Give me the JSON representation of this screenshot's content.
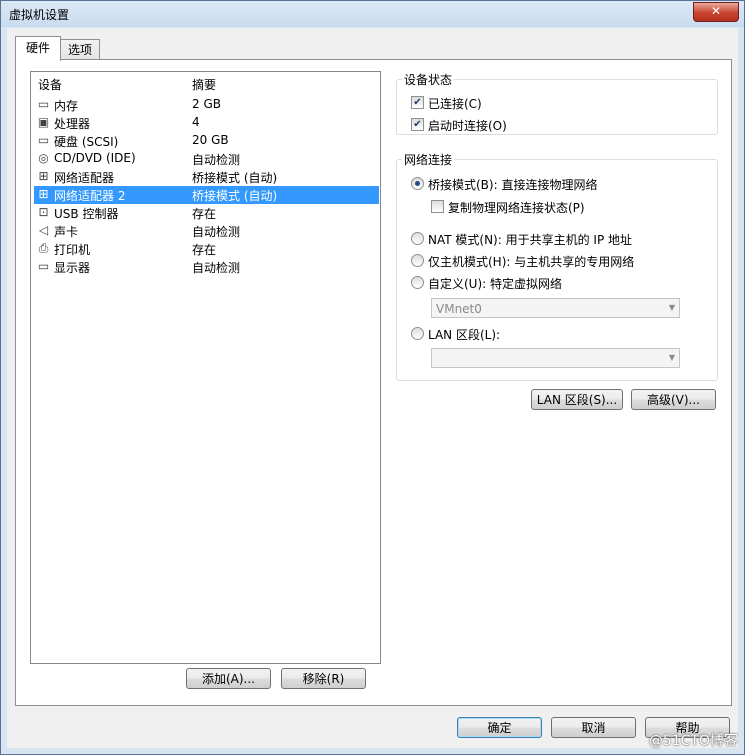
{
  "window": {
    "title": "虚拟机设置",
    "close_label": "✕"
  },
  "tabs": [
    {
      "label": "硬件"
    },
    {
      "label": "选项"
    }
  ],
  "device_list": {
    "headers": {
      "device": "设备",
      "summary": "摘要"
    },
    "rows": [
      {
        "icon": "memory-icon",
        "glyph": "▭",
        "name": "内存",
        "summary": "2 GB"
      },
      {
        "icon": "processor-icon",
        "glyph": "▣",
        "name": "处理器",
        "summary": "4"
      },
      {
        "icon": "harddisk-icon",
        "glyph": "▭",
        "name": "硬盘 (SCSI)",
        "summary": "20 GB"
      },
      {
        "icon": "cd-dvd-icon",
        "glyph": "◎",
        "name": "CD/DVD (IDE)",
        "summary": "自动检测"
      },
      {
        "icon": "network-adapter-icon",
        "glyph": "⊞",
        "name": "网络适配器",
        "summary": "桥接模式 (自动)"
      },
      {
        "icon": "network-adapter-icon",
        "glyph": "⊞",
        "name": "网络适配器 2",
        "summary": "桥接模式 (自动)",
        "selected": true
      },
      {
        "icon": "usb-controller-icon",
        "glyph": "⊡",
        "name": "USB 控制器",
        "summary": "存在"
      },
      {
        "icon": "sound-card-icon",
        "glyph": "◁",
        "name": "声卡",
        "summary": "自动检测"
      },
      {
        "icon": "printer-icon",
        "glyph": "⎙",
        "name": "打印机",
        "summary": "存在"
      },
      {
        "icon": "display-icon",
        "glyph": "▭",
        "name": "显示器",
        "summary": "自动检测"
      }
    ],
    "add_button": "添加(A)...",
    "remove_button": "移除(R)"
  },
  "device_status": {
    "title": "设备状态",
    "connected": {
      "label": "已连接(C)",
      "checked": true
    },
    "connect_at_power_on": {
      "label": "启动时连接(O)",
      "checked": true
    }
  },
  "network_connection": {
    "title": "网络连接",
    "bridged": {
      "label": "桥接模式(B): 直接连接物理网络",
      "selected": true
    },
    "replicate_state": {
      "label": "复制物理网络连接状态(P)",
      "checked": false
    },
    "nat": {
      "label": "NAT 模式(N): 用于共享主机的 IP 地址",
      "selected": false
    },
    "host_only": {
      "label": "仅主机模式(H): 与主机共享的专用网络",
      "selected": false
    },
    "custom": {
      "label": "自定义(U): 特定虚拟网络",
      "selected": false
    },
    "custom_select": "VMnet0",
    "lan_segment": {
      "label": "LAN 区段(L):",
      "selected": false
    },
    "lan_select": ""
  },
  "buttons": {
    "lan_segments": "LAN 区段(S)...",
    "advanced": "高级(V)...",
    "ok": "确定",
    "cancel": "取消",
    "help": "帮助"
  },
  "watermark": "@51CTO博客"
}
